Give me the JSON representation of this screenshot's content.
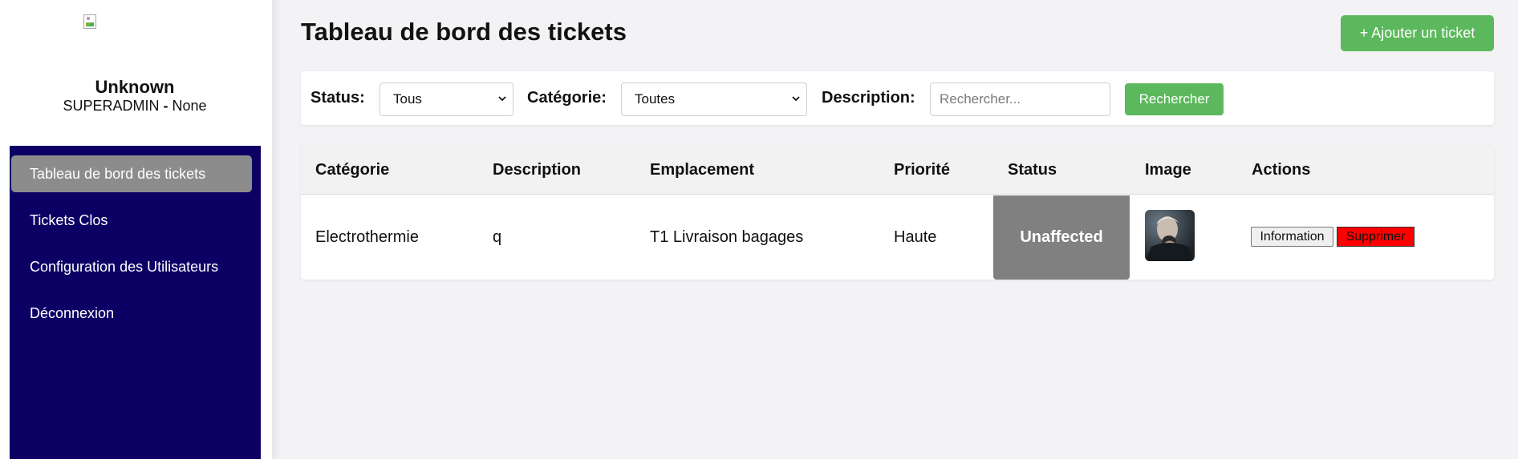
{
  "user": {
    "name": "Unknown",
    "role": "SUPERADMIN",
    "role_separator": "-",
    "site": "None"
  },
  "sidebar": {
    "items": [
      {
        "label": "Tableau de bord des tickets",
        "active": true
      },
      {
        "label": "Tickets Clos",
        "active": false
      },
      {
        "label": "Configuration des Utilisateurs",
        "active": false
      },
      {
        "label": "Déconnexion",
        "active": false
      }
    ]
  },
  "header": {
    "title": "Tableau de bord des tickets",
    "add_button": "+ Ajouter un ticket"
  },
  "filters": {
    "status_label": "Status:",
    "status_value": "Tous",
    "category_label": "Catégorie:",
    "category_value": "Toutes",
    "description_label": "Description:",
    "description_placeholder": "Rechercher...",
    "description_value": "",
    "search_button": "Rechercher"
  },
  "table": {
    "headers": [
      "Catégorie",
      "Description",
      "Emplacement",
      "Priorité",
      "Status",
      "Image",
      "Actions"
    ],
    "rows": [
      {
        "category": "Electrothermie",
        "description": "q",
        "location": "T1 Livraison bagages",
        "priority": "Haute",
        "status": "Unaffected",
        "status_color": "#808080",
        "image_icon": "ticket-photo-thumbnail",
        "actions": {
          "info": "Information",
          "delete": "Supprimer"
        }
      }
    ]
  },
  "colors": {
    "sidebar_nav_bg": "#0d0065",
    "active_nav_bg": "#8c8c8c",
    "primary_green": "#5cb85c",
    "delete_red": "#ff0000",
    "page_bg": "#f3f3f6"
  }
}
